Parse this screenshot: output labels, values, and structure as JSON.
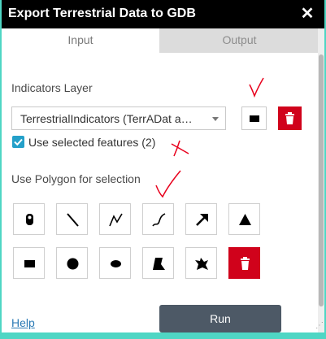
{
  "window": {
    "title": "Export Terrestrial Data to GDB",
    "close_icon": "close-icon"
  },
  "tabs": [
    {
      "label": "Input",
      "active": true
    },
    {
      "label": "Output",
      "active": false
    }
  ],
  "indicators": {
    "label": "Indicators Layer",
    "selected_layer": "TerrestrialIndicators (TerrADat a…",
    "rectangle_icon": "rectangle-icon",
    "trash_icon": "trash-icon"
  },
  "selection": {
    "checkbox_checked": true,
    "checkbox_label": "Use selected features (2)"
  },
  "polygon": {
    "label": "Use Polygon for selection",
    "tools_row1": [
      "point-icon",
      "line-icon",
      "polyline-icon",
      "freehand-polyline-icon",
      "arrow-icon",
      "triangle-icon"
    ],
    "tools_row2": [
      "rectangle-icon",
      "circle-icon",
      "ellipse-icon",
      "polygon-icon",
      "freehand-polygon-icon",
      "trash-icon"
    ]
  },
  "footer": {
    "help_label": "Help",
    "run_label": "Run"
  },
  "colors": {
    "titlebar": "#000000",
    "accent_border": "#4fd6c4",
    "danger": "#d0021b",
    "checkbox": "#24a0c9",
    "run_button": "#4d5966",
    "annotation": "#e8001c"
  }
}
